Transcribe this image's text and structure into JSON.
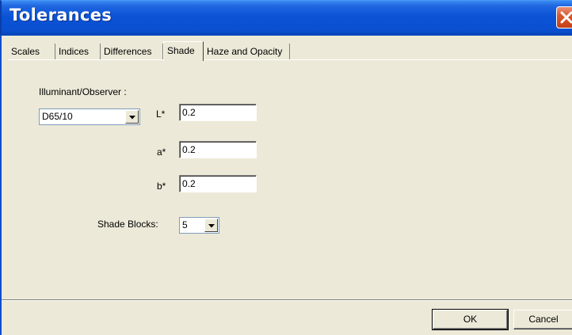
{
  "window": {
    "title": "Tolerances"
  },
  "tabs": [
    {
      "label": "Scales"
    },
    {
      "label": "Indices"
    },
    {
      "label": "Differences"
    },
    {
      "label": "Shade"
    },
    {
      "label": "Haze and Opacity"
    }
  ],
  "active_tab": "Shade",
  "shade": {
    "illuminant_label": "Illuminant/Observer :",
    "illuminant_value": "D65/10",
    "l_label": "L*",
    "l_value": "0.2",
    "a_label": "a*",
    "a_value": "0.2",
    "b_label": "b*",
    "b_value": "0.2",
    "blocks_label": "Shade Blocks:",
    "blocks_value": "5"
  },
  "buttons": {
    "ok": "OK",
    "cancel": "Cancel"
  },
  "colors": {
    "titlebar": "#0a53d6",
    "close": "#d95a2f",
    "dialog": "#ece9d8"
  },
  "icons": {
    "close": "close-x-icon",
    "dropdown": "chevron-down-icon"
  }
}
